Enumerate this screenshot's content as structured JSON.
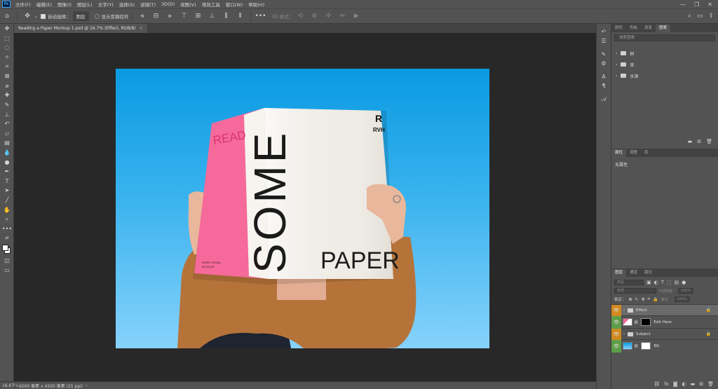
{
  "menu": {
    "logo": "Ps",
    "items": [
      "文件(F)",
      "编辑(E)",
      "图像(I)",
      "图层(L)",
      "文字(Y)",
      "选择(S)",
      "滤镜(T)",
      "3D(D)",
      "视图(V)",
      "增效工具",
      "窗口(W)",
      "帮助(H)"
    ],
    "window_controls": [
      "—",
      "❐",
      "✕"
    ]
  },
  "options": {
    "auto_select_label": "自动选择：",
    "auto_select_value": "图层",
    "show_transform_label": "显示变换控件",
    "mode_3d_label": "3D 模式："
  },
  "document": {
    "tab_title": "Reading a Paper Mockup 1.psd @ 16.7% (Effect, RGB/8)",
    "tab_close": "×"
  },
  "canvas_text": {
    "read": "READ",
    "some": "SOME",
    "paper": "PAPER",
    "brand_mark": "R",
    "brand": "RVH",
    "small_credit_1": "RIVER VISUAL",
    "small_credit_2": "MOCKUP"
  },
  "status": {
    "zoom": "16.67%",
    "doc_size": "6000 像素 x 4500 像素 (25 ppi)"
  },
  "library_panel": {
    "tabs": [
      "颜色",
      "色板",
      "渐变",
      "图案"
    ],
    "active_tab": "图案",
    "search_placeholder": "搜索图案",
    "groups": [
      "树",
      "草",
      "水滴"
    ]
  },
  "properties_panel": {
    "tabs": [
      "属性",
      "调整",
      "库"
    ],
    "active_tab": "属性",
    "content": "无属性"
  },
  "layers_panel": {
    "tabs": [
      "图层",
      "通道",
      "路径"
    ],
    "active_tab": "图层",
    "kind_label": "类型",
    "blend_mode": "穿透",
    "opacity_label": "不透明度：",
    "opacity_value": "100%",
    "lock_label": "锁定：",
    "fill_label": "填充：",
    "fill_value": "100%",
    "layers": [
      {
        "name": "Effect",
        "type": "group",
        "eye_color": "#d0891f",
        "locked": true,
        "selected": true
      },
      {
        "name": "Edit Here",
        "type": "smart",
        "eye_color": "#5f9e48",
        "locked": false,
        "selected": false
      },
      {
        "name": "Subject",
        "type": "group",
        "eye_color": "#d0891f",
        "locked": true,
        "selected": false
      },
      {
        "name": "BG",
        "type": "image",
        "eye_color": "#5f9e48",
        "locked": false,
        "selected": false
      }
    ]
  },
  "colors": {
    "pink_page": "#f56a9a",
    "sweater": "#b5733a",
    "skin": "#e9b79b"
  }
}
